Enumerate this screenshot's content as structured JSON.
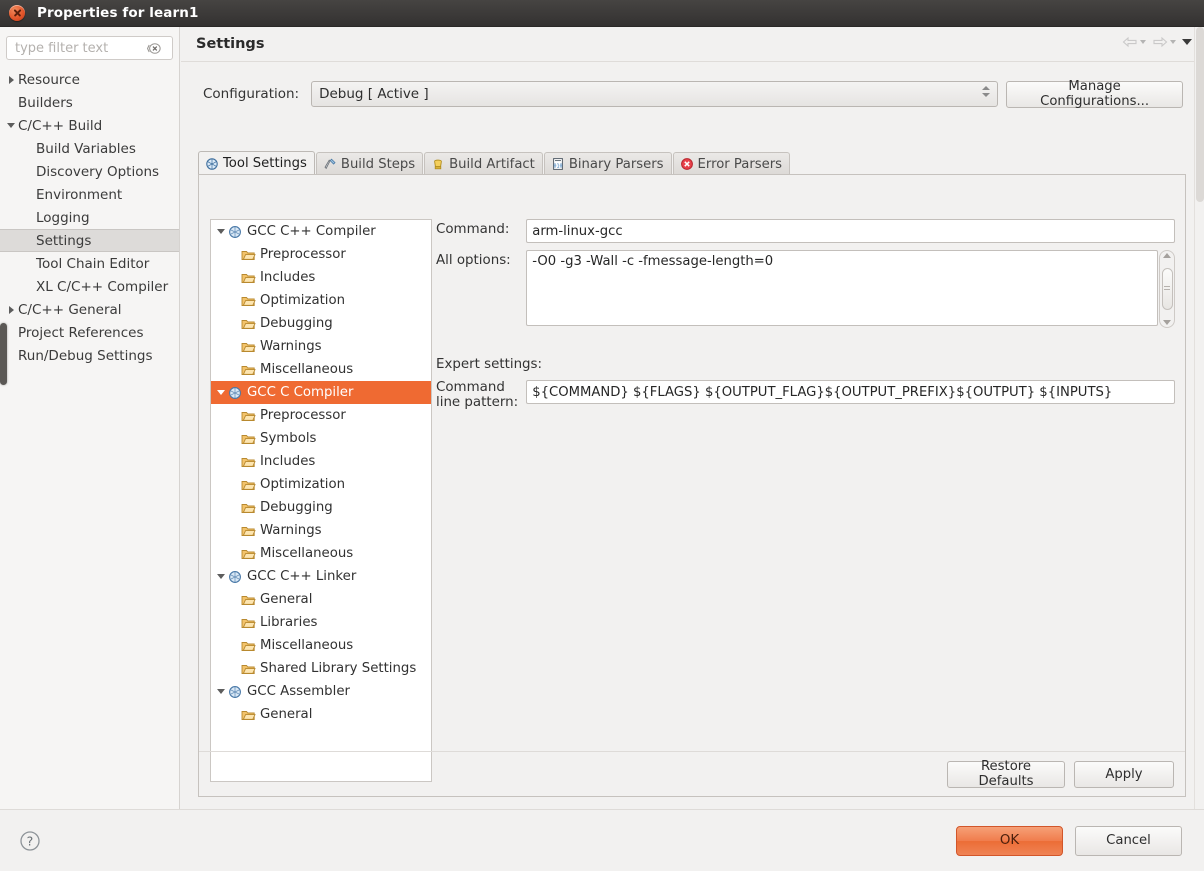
{
  "window": {
    "title": "Properties for learn1",
    "close_icon": "close-icon"
  },
  "sidebar": {
    "filter": {
      "value": "",
      "placeholder": "type filter text",
      "clear_icon": "clear-text-icon"
    },
    "items": [
      {
        "label": "Resource",
        "level": 0,
        "twisty": "collapsed",
        "selected": false
      },
      {
        "label": "Builders",
        "level": 0,
        "twisty": "none",
        "selected": false
      },
      {
        "label": "C/C++ Build",
        "level": 0,
        "twisty": "expanded",
        "selected": false
      },
      {
        "label": "Build Variables",
        "level": 1,
        "twisty": "none",
        "selected": false
      },
      {
        "label": "Discovery Options",
        "level": 1,
        "twisty": "none",
        "selected": false
      },
      {
        "label": "Environment",
        "level": 1,
        "twisty": "none",
        "selected": false
      },
      {
        "label": "Logging",
        "level": 1,
        "twisty": "none",
        "selected": false
      },
      {
        "label": "Settings",
        "level": 1,
        "twisty": "none",
        "selected": true
      },
      {
        "label": "Tool Chain Editor",
        "level": 1,
        "twisty": "none",
        "selected": false
      },
      {
        "label": "XL C/C++ Compiler",
        "level": 1,
        "twisty": "none",
        "selected": false
      },
      {
        "label": "C/C++ General",
        "level": 0,
        "twisty": "collapsed",
        "selected": false
      },
      {
        "label": "Project References",
        "level": 0,
        "twisty": "none",
        "selected": false
      },
      {
        "label": "Run/Debug Settings",
        "level": 0,
        "twisty": "none",
        "selected": false
      }
    ]
  },
  "header": {
    "title": "Settings",
    "back_icon": "back-arrow-icon",
    "forward_icon": "forward-arrow-icon",
    "menu_icon": "view-menu-icon"
  },
  "configuration": {
    "label": "Configuration:",
    "value": "Debug  [ Active ]",
    "manage_label": "Manage Configurations..."
  },
  "tabs": [
    {
      "label": "Tool Settings",
      "icon": "tool-settings-icon",
      "active": true
    },
    {
      "label": "Build Steps",
      "icon": "build-steps-icon",
      "active": false
    },
    {
      "label": "Build Artifact",
      "icon": "build-artifact-icon",
      "active": false
    },
    {
      "label": "Binary Parsers",
      "icon": "binary-parsers-icon",
      "active": false
    },
    {
      "label": "Error Parsers",
      "icon": "error-parsers-icon",
      "active": false
    }
  ],
  "tool_tree": [
    {
      "label": "GCC C++ Compiler",
      "level": 0,
      "twisty": "expanded",
      "icon": "tool-icon",
      "selected": false
    },
    {
      "label": "Preprocessor",
      "level": 1,
      "twisty": "none",
      "icon": "folder-icon",
      "selected": false
    },
    {
      "label": "Includes",
      "level": 1,
      "twisty": "none",
      "icon": "folder-icon",
      "selected": false
    },
    {
      "label": "Optimization",
      "level": 1,
      "twisty": "none",
      "icon": "folder-icon",
      "selected": false
    },
    {
      "label": "Debugging",
      "level": 1,
      "twisty": "none",
      "icon": "folder-icon",
      "selected": false
    },
    {
      "label": "Warnings",
      "level": 1,
      "twisty": "none",
      "icon": "folder-icon",
      "selected": false
    },
    {
      "label": "Miscellaneous",
      "level": 1,
      "twisty": "none",
      "icon": "folder-icon",
      "selected": false
    },
    {
      "label": "GCC C Compiler",
      "level": 0,
      "twisty": "expanded",
      "icon": "tool-icon",
      "selected": true
    },
    {
      "label": "Preprocessor",
      "level": 1,
      "twisty": "none",
      "icon": "folder-icon",
      "selected": false
    },
    {
      "label": "Symbols",
      "level": 1,
      "twisty": "none",
      "icon": "folder-icon",
      "selected": false
    },
    {
      "label": "Includes",
      "level": 1,
      "twisty": "none",
      "icon": "folder-icon",
      "selected": false
    },
    {
      "label": "Optimization",
      "level": 1,
      "twisty": "none",
      "icon": "folder-icon",
      "selected": false
    },
    {
      "label": "Debugging",
      "level": 1,
      "twisty": "none",
      "icon": "folder-icon",
      "selected": false
    },
    {
      "label": "Warnings",
      "level": 1,
      "twisty": "none",
      "icon": "folder-icon",
      "selected": false
    },
    {
      "label": "Miscellaneous",
      "level": 1,
      "twisty": "none",
      "icon": "folder-icon",
      "selected": false
    },
    {
      "label": "GCC C++ Linker",
      "level": 0,
      "twisty": "expanded",
      "icon": "tool-icon",
      "selected": false
    },
    {
      "label": "General",
      "level": 1,
      "twisty": "none",
      "icon": "folder-icon",
      "selected": false
    },
    {
      "label": "Libraries",
      "level": 1,
      "twisty": "none",
      "icon": "folder-icon",
      "selected": false
    },
    {
      "label": "Miscellaneous",
      "level": 1,
      "twisty": "none",
      "icon": "folder-icon",
      "selected": false
    },
    {
      "label": "Shared Library Settings",
      "level": 1,
      "twisty": "none",
      "icon": "folder-icon",
      "selected": false
    },
    {
      "label": "GCC Assembler",
      "level": 0,
      "twisty": "expanded",
      "icon": "tool-icon",
      "selected": false
    },
    {
      "label": "General",
      "level": 1,
      "twisty": "none",
      "icon": "folder-icon",
      "selected": false
    }
  ],
  "form": {
    "command_label": "Command:",
    "command_value": "arm-linux-gcc",
    "all_options_label": "All options:",
    "all_options_value": "-O0 -g3 -Wall -c -fmessage-length=0",
    "expert_settings_label": "Expert settings:",
    "pattern_label_line1": "Command",
    "pattern_label_line2": "line pattern:",
    "pattern_value": "${COMMAND} ${FLAGS} ${OUTPUT_FLAG}${OUTPUT_PREFIX}${OUTPUT} ${INPUTS}"
  },
  "panel_buttons": {
    "restore_defaults": "Restore Defaults",
    "apply": "Apply"
  },
  "dialog_buttons": {
    "help_icon": "help-icon",
    "ok": "OK",
    "cancel": "Cancel"
  },
  "colors": {
    "titlebar": "#3b3938",
    "selection_orange": "#ef6a32",
    "ok_button": "#ee7a45",
    "sidebar_selection": "#dddbd9"
  }
}
